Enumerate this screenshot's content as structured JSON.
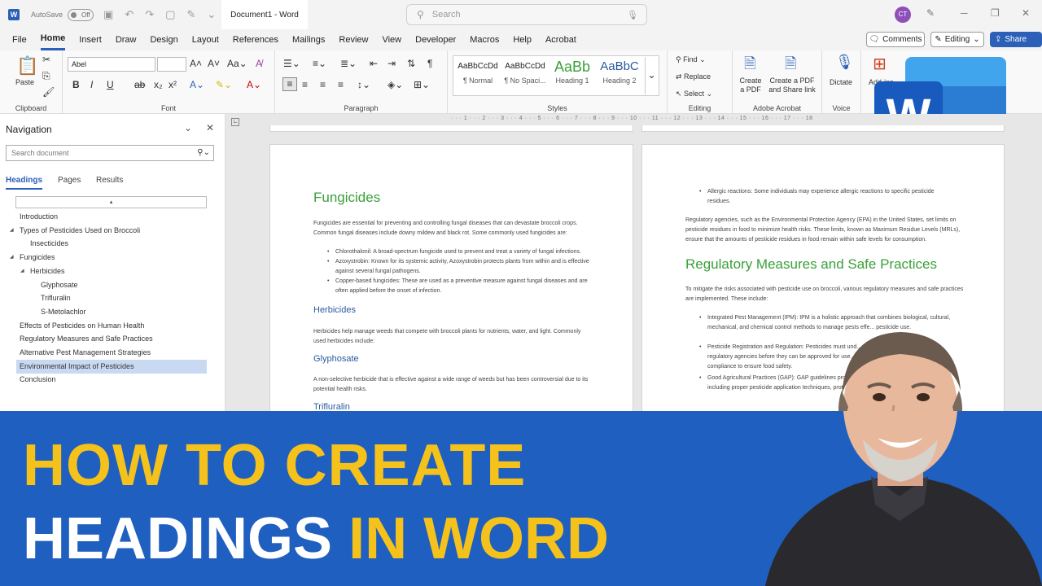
{
  "titlebar": {
    "autosave_label": "AutoSave",
    "autosave_state": "Off",
    "doc_title": "Document1  -  Word",
    "search_placeholder": "Search",
    "user_initials": "CT"
  },
  "menu": {
    "items": [
      "File",
      "Home",
      "Insert",
      "Draw",
      "Design",
      "Layout",
      "References",
      "Mailings",
      "Review",
      "View",
      "Developer",
      "Macros",
      "Help",
      "Acrobat"
    ],
    "active": "Home",
    "comments_label": "Comments",
    "editing_label": "Editing",
    "share_label": "Share"
  },
  "ribbon": {
    "clipboard": {
      "paste": "Paste",
      "label": "Clipboard"
    },
    "font": {
      "family": "Abel",
      "size": "",
      "label": "Font"
    },
    "paragraph": {
      "label": "Paragraph"
    },
    "styles": {
      "label": "Styles",
      "items": [
        {
          "sample": "AaBbCcDd",
          "name": "¶ Normal"
        },
        {
          "sample": "AaBbCcDd",
          "name": "¶ No Spaci..."
        },
        {
          "sample": "AaBb",
          "name": "Heading 1"
        },
        {
          "sample": "AaBbC",
          "name": "Heading 2"
        }
      ]
    },
    "editing": {
      "find": "Find",
      "replace": "Replace",
      "select": "Select",
      "label": "Editing"
    },
    "acrobat": {
      "create_pdf": "Create a PDF",
      "create_share": "Create a PDF and Share link",
      "label": "Adobe Acrobat"
    },
    "voice": {
      "dictate": "Dictate",
      "label": "Voice"
    },
    "addins": {
      "label": "Add-ins"
    }
  },
  "navigation": {
    "title": "Navigation",
    "search_placeholder": "Search document",
    "tabs": [
      "Headings",
      "Pages",
      "Results"
    ],
    "items": [
      {
        "text": "Introduction",
        "level": 1,
        "expander": false
      },
      {
        "text": "Types of Pesticides Used on Broccoli",
        "level": 1,
        "expander": true
      },
      {
        "text": "Insecticides",
        "level": 2,
        "expander": false
      },
      {
        "text": "Fungicides",
        "level": 1,
        "expander": true
      },
      {
        "text": "Herbicides",
        "level": 2,
        "expander": true
      },
      {
        "text": "Glyphosate",
        "level": 3,
        "expander": false
      },
      {
        "text": "Trifluralin",
        "level": 3,
        "expander": false
      },
      {
        "text": "S-Metolachlor",
        "level": 3,
        "expander": false
      },
      {
        "text": "Effects of Pesticides on Human Health",
        "level": 1,
        "expander": false
      },
      {
        "text": "Regulatory Measures and Safe Practices",
        "level": 1,
        "expander": false
      },
      {
        "text": "Alternative Pest Management Strategies",
        "level": 1,
        "expander": false
      },
      {
        "text": "Environmental Impact of Pesticides",
        "level": 1,
        "expander": false,
        "selected": true
      },
      {
        "text": "Conclusion",
        "level": 1,
        "expander": false
      }
    ]
  },
  "page_left": {
    "h1": "Fungicides",
    "intro": "Fungicides are essential for preventing and controlling fungal diseases that can devastate broccoli crops. Common fungal diseases include downy mildew and black rot. Some commonly used fungicides are:",
    "bullets": [
      "Chlorothalonil: A broad-spectrum fungicide used to prevent and treat a variety of fungal infections.",
      "Azoxystrobin: Known for its systemic activity, Azoxystrobin protects plants from within and is effective against several fungal pathogens.",
      "Copper-based fungicides: These are used as a preventive measure against fungal diseases and are often applied before the onset of infection."
    ],
    "h2_herbicides": "Herbicides",
    "herbicides_text": "Herbicides help manage weeds that compete with broccoli plants for nutrients, water, and light. Commonly used herbicides include:",
    "h2_glyphosate": "Glyphosate",
    "glyphosate_text": "A non-selective herbicide that is effective against a wide range of weeds but has been controversial due to its potential health risks.",
    "h2_trifluralin": "Trifluralin"
  },
  "page_right": {
    "bullet_top": "Allergic reactions: Some individuals may experience allergic reactions to specific pesticide residues.",
    "reg_text": "Regulatory agencies, such as the Environmental Protection Agency (EPA) in the United States, set limits on pesticide residues in food to minimize health risks. These limits, known as Maximum Residue Levels (MRLs), ensure that the amounts of pesticide residues in food remain within safe levels for consumption.",
    "h1": "Regulatory Measures and Safe Practices",
    "intro": "To mitigate the risks associated with pesticide use on broccoli, various regulatory measures and safe practices are implemented. These include:",
    "bullets": [
      "Integrated Pest Management (IPM): IPM is a holistic approach that combines biological, cultural, mechanical, and chemical control methods to manage pests effe... pesticide use.",
      "Pesticide Registration and Regulation: Pesticides must und... regulatory agencies before they can be approved for use... compliance to ensure food safety.",
      "Good Agricultural Practices (GAP): GAP guidelines prom... including proper pesticide application techniques, prot... monitoring."
    ]
  },
  "banner": {
    "line1": "HOW TO CREATE",
    "line2_white": "HEADINGS",
    "line2_yellow": "IN WORD"
  },
  "colors": {
    "word_blue": "#1f5fbf",
    "banner_yellow": "#f5c21b",
    "heading_green": "#3aa03a",
    "heading_blue": "#2a5a9c"
  }
}
